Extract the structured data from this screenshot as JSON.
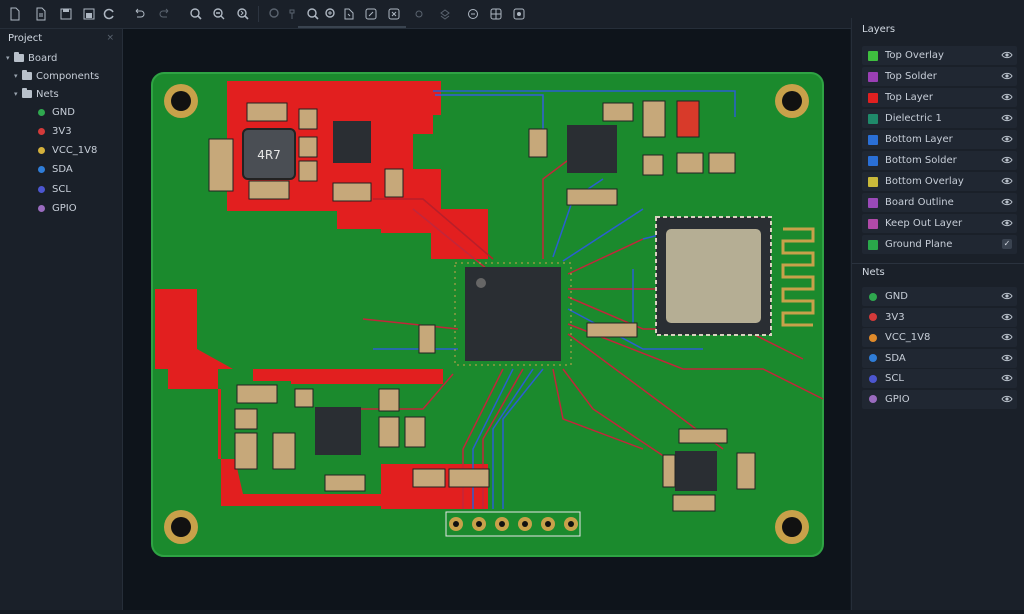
{
  "toolbar": {
    "icons": [
      "new-file-icon",
      "open-file-icon",
      "save-icon",
      "save-all-icon",
      "refresh-icon",
      "undo-icon",
      "redo-icon",
      "zoom-in-icon",
      "zoom-fit-icon",
      "zoom-out-icon",
      "select-icon",
      "pan-icon",
      "zoom-area-icon",
      "measure-icon",
      "route-icon",
      "via-icon",
      "drc-icon",
      "settings-icon",
      "layers-icon",
      "export-icon"
    ]
  },
  "project": {
    "title": "Project",
    "tree": [
      {
        "label": "Board",
        "level": 0,
        "type": "folder"
      },
      {
        "label": "Components",
        "level": 1,
        "type": "folder"
      },
      {
        "label": "Nets",
        "level": 1,
        "type": "folder"
      },
      {
        "label": "GND",
        "level": 2,
        "type": "net",
        "color": "#2fa84f"
      },
      {
        "label": "3V3",
        "level": 2,
        "type": "net",
        "color": "#d33a3a"
      },
      {
        "label": "VCC_1V8",
        "level": 2,
        "type": "net",
        "color": "#d4b13c"
      },
      {
        "label": "SDA",
        "level": 2,
        "type": "net",
        "color": "#2f7dd8"
      },
      {
        "label": "SCL",
        "level": 2,
        "type": "net",
        "color": "#4c56d0"
      },
      {
        "label": "GPIO",
        "level": 2,
        "type": "net",
        "color": "#9a6bbf"
      }
    ]
  },
  "canvas": {
    "inductor_label": "4R7",
    "board_color": "#1b8a2d",
    "copper_color": "#e21f1f",
    "pad_color": "#c8a14a"
  },
  "layers": {
    "title": "Layers",
    "items": [
      {
        "label": "Top Overlay",
        "color": "#3fbf3f",
        "control": "eye"
      },
      {
        "label": "Top Solder",
        "color": "#9b3fb5",
        "control": "eye"
      },
      {
        "label": "Top Layer",
        "color": "#e02020",
        "control": "eye"
      },
      {
        "label": "Dielectric 1",
        "color": "#1f8a6a",
        "control": "eye"
      },
      {
        "label": "Bottom Layer",
        "color": "#2a6fd6",
        "control": "eye"
      },
      {
        "label": "Bottom Solder",
        "color": "#2a6fd6",
        "control": "eye"
      },
      {
        "label": "Bottom Overlay",
        "color": "#c9b93a",
        "control": "eye"
      },
      {
        "label": "Board Outline",
        "color": "#9a49b8",
        "control": "eye"
      },
      {
        "label": "Keep Out Layer",
        "color": "#b04aa8",
        "control": "eye"
      },
      {
        "label": "Ground Plane",
        "color": "#2aa84a",
        "control": "check"
      }
    ]
  },
  "nets": {
    "title": "Nets",
    "items": [
      {
        "label": "GND",
        "color": "#2fa84f"
      },
      {
        "label": "3V3",
        "color": "#d33a3a"
      },
      {
        "label": "VCC_1V8",
        "color": "#e08a2a"
      },
      {
        "label": "SDA",
        "color": "#2f7dd8"
      },
      {
        "label": "SCL",
        "color": "#4c56d0"
      },
      {
        "label": "GPIO",
        "color": "#9a6bbf"
      }
    ]
  }
}
